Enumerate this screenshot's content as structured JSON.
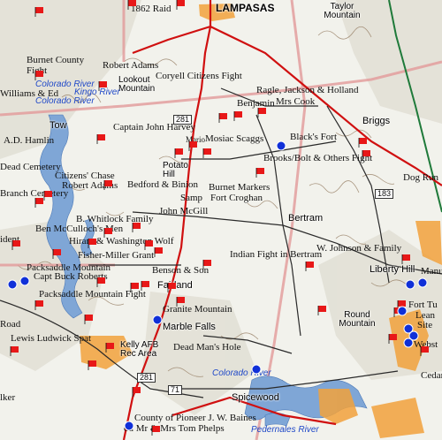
{
  "colors": {
    "background": "#f2f2ec",
    "terrain": "#d8d6c8",
    "contour": "#7a5a3a",
    "county_line": "#e29a9a",
    "highway": "#d01010",
    "road": "#2a2a2a",
    "water": "#7fa6d6",
    "urban": "#f2a23c",
    "green_edge": "#1f7a3a",
    "flag": "#e81818",
    "blue_marker": "#1030d8",
    "water_label": "#1f48c8"
  },
  "places": [
    {
      "id": "lampasas",
      "label": "LAMPASAS",
      "kind": "town"
    },
    {
      "id": "taylor-mountain",
      "label": "Taylor Mountain",
      "kind": "town"
    },
    {
      "id": "briggs",
      "label": "Briggs",
      "kind": "town"
    },
    {
      "id": "tow",
      "label": "Tow",
      "kind": "town"
    },
    {
      "id": "potato-hill",
      "label": "Potato Hill",
      "kind": "town"
    },
    {
      "id": "bertram",
      "label": "Bertram",
      "kind": "town"
    },
    {
      "id": "fairland",
      "label": "Fairland",
      "kind": "town"
    },
    {
      "id": "marble-falls",
      "label": "Marble Falls",
      "kind": "town"
    },
    {
      "id": "spicewood",
      "label": "Spicewood",
      "kind": "town"
    },
    {
      "id": "liberty-hill",
      "label": "Liberty Hill",
      "kind": "town"
    },
    {
      "id": "round-mountain",
      "label": "Round Mountain",
      "kind": "town"
    },
    {
      "id": "kelly-afb",
      "label": "Kelly AFB Rec Area",
      "kind": "town"
    },
    {
      "id": "lookout-mountain",
      "label": "Lookout Mountain",
      "kind": "town"
    }
  ],
  "map_labels": [
    "1862 Raid",
    "Burnet County Fight",
    "Robert Adams",
    "Coryell Citizens Fight",
    "Ragle, Jackson & Holland",
    "Benjamin",
    "Mrs Cook",
    "Williams & Ed",
    "A.D. Hamlin",
    "Captain John Harvey",
    "Mario",
    "Mosiac Scaggs",
    "Black's Fort",
    "Brooks/Bolt & Others Fight",
    "Dog Run",
    "Dead Cemetery",
    "Citizens' Chase",
    "Robert Adams",
    "Bedford & Binion",
    "Branch Cemetery",
    "Samp",
    "Burnet Markers",
    "Fort Croghan",
    "B. Whitlock Family",
    "John McGill",
    "Ben McCulloch's Men",
    "Hiram & Washington Wolf",
    "ident",
    "W. Johnson & Family",
    "Fisher-Miller Grant",
    "Indian Fight in Bertram",
    "Packsaddle Mountain",
    "Capt Buck Roberts",
    "Benson & Son",
    "Packsaddle Mountain Fight",
    "Granite Mountain",
    "Road",
    "Lewis Ludwick Spat",
    "Dead Man's Hole",
    "Fort Tu",
    "Lean",
    "Site",
    "Webst",
    "Cedar",
    "Manu",
    "lker",
    "County of Pioneer J. W. Baines",
    "ou Mr & Mrs Tom Phelps"
  ],
  "water_labels": [
    "Colorado River",
    "Kingo River",
    "Colorado River",
    "Colorado River",
    "Pedernales River"
  ],
  "shields": [
    "281",
    "281",
    "71",
    "183"
  ],
  "legend_marks": {
    "flag": "battle site flag",
    "circle": "fort / historic marker"
  }
}
